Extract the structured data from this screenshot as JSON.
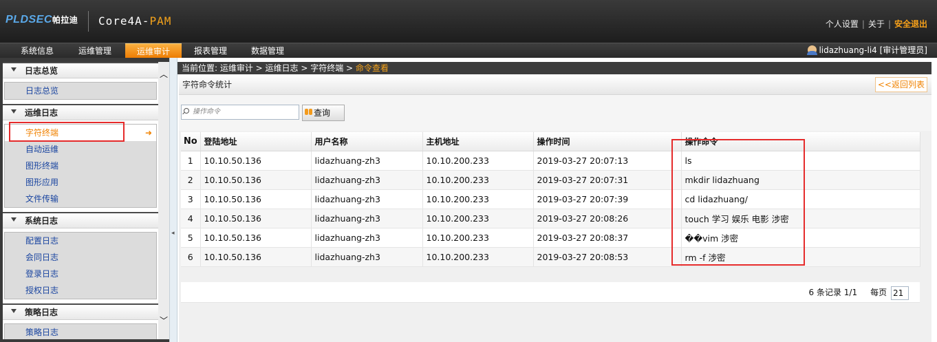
{
  "header": {
    "logo_text": "PLDSEC",
    "logo_cn": "帕拉迪",
    "product_prefix": "Core4A-",
    "product_suffix": "PAM",
    "links": [
      "个人设置",
      "关于",
      "安全退出"
    ]
  },
  "nav": {
    "tabs": [
      "系统信息",
      "运维管理",
      "运维审计",
      "报表管理",
      "数据管理"
    ],
    "active_tab": "运维审计",
    "user": "lidazhuang-li4 [审计管理员]"
  },
  "sidebar": {
    "sections": [
      {
        "title": "日志总览",
        "items": [
          "日志总览"
        ]
      },
      {
        "title": "运维日志",
        "items": [
          "字符终端",
          "自动运维",
          "图形终端",
          "图形应用",
          "文件传输"
        ],
        "active_item": "字符终端"
      },
      {
        "title": "系统日志",
        "items": [
          "配置日志",
          "会同日志",
          "登录日志",
          "授权日志"
        ]
      },
      {
        "title": "策略日志",
        "items": [
          "策略日志"
        ]
      }
    ]
  },
  "breadcrumb": {
    "prefix": "当前位置: 运维审计 > 运维日志 > 字符终端 > ",
    "current": "命令查看"
  },
  "panel": {
    "title": "字符命令统计",
    "back_label": "<<返回列表",
    "search_placeholder": "操作命令",
    "query_label": "查询"
  },
  "table": {
    "columns": [
      "No",
      "登陆地址",
      "用户名称",
      "主机地址",
      "操作时间",
      "操作命令"
    ],
    "rows": [
      [
        "1",
        "10.10.50.136",
        "lidazhuang-zh3",
        "10.10.200.233",
        "2019-03-27 20:07:13",
        "ls"
      ],
      [
        "2",
        "10.10.50.136",
        "lidazhuang-zh3",
        "10.10.200.233",
        "2019-03-27 20:07:31",
        "mkdir lidazhuang"
      ],
      [
        "3",
        "10.10.50.136",
        "lidazhuang-zh3",
        "10.10.200.233",
        "2019-03-27 20:07:39",
        "cd lidazhuang/"
      ],
      [
        "4",
        "10.10.50.136",
        "lidazhuang-zh3",
        "10.10.200.233",
        "2019-03-27 20:08:26",
        "touch 学习 娱乐 电影 涉密"
      ],
      [
        "5",
        "10.10.50.136",
        "lidazhuang-zh3",
        "10.10.200.233",
        "2019-03-27 20:08:37",
        "��vim 涉密"
      ],
      [
        "6",
        "10.10.50.136",
        "lidazhuang-zh3",
        "10.10.200.233",
        "2019-03-27 20:08:53",
        "rm -f 涉密"
      ]
    ]
  },
  "pager": {
    "summary": "6 条记录 1/1",
    "per_page_label": "每页",
    "per_page_value": "21"
  },
  "colors": {
    "accent": "#f08200",
    "highlight_box": "#e52a2a",
    "link": "#1a45a0"
  }
}
